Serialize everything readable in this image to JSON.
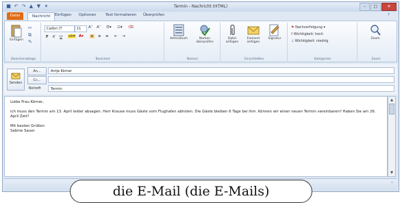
{
  "window": {
    "title": "Termin - Nachricht (HTML)",
    "accent": "#e06b15"
  },
  "qat": {
    "icons": [
      "save-icon",
      "undo-icon",
      "redo-icon",
      "up-icon",
      "down-icon",
      "customize-icon"
    ]
  },
  "tabs": {
    "file": "Datei",
    "items": [
      "Nachricht",
      "Einfügen",
      "Optionen",
      "Text formatieren",
      "Überprüfen"
    ]
  },
  "ribbon": {
    "clipboard": {
      "paste": "Einfügen",
      "label": "Zwischenablage"
    },
    "font": {
      "name": "Calibri (T",
      "size": "11",
      "label": "Basictext"
    },
    "names": {
      "addressbook": "Adressbuch",
      "checknames": "Namen überprüfen",
      "label": "Namen"
    },
    "include": {
      "attach_file": "Datei anfügen",
      "attach_item": "Element anfügen",
      "signature": "Signatur",
      "label": "Einschließen"
    },
    "tags": {
      "followup": "Nachverfolgung",
      "high": "Wichtigkeit: hoch",
      "low": "Wichtigkeit: niedrig",
      "label": "Kategorien"
    },
    "zoom": {
      "zoom": "Zoom",
      "label": "Zoom"
    }
  },
  "header": {
    "send_label": "Senden",
    "to_button": "An...",
    "cc_button": "Cc...",
    "subject_label": "Betreff:",
    "to_value": "Antje Körner",
    "cc_value": "",
    "subject_value": "Termin"
  },
  "message": {
    "greeting": "Liebe Frau Körner,",
    "paragraph": "ich muss den Termin am 13. April leider absagen. Herr Krause muss Gäste vom Flughafen abholen. Die Gäste bleiben 6 Tage bei ihm. Können wir einen neuen Termin vereinbaren? Haben Sie am 26. April Zeit?",
    "closing": "Mit besten Grüßen",
    "signature": "Sabine Sauer"
  },
  "caption": "die E-Mail (die E-Mails)"
}
